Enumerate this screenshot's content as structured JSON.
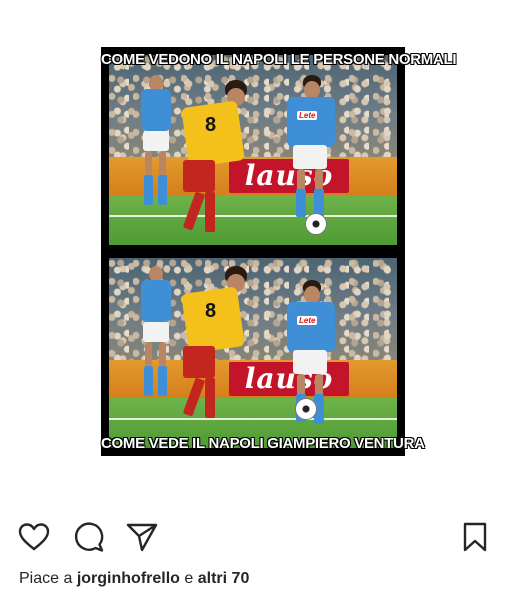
{
  "post": {
    "meme": {
      "caption_top": "COME VEDONO IL NAPOLI LE PERSONE NORMALI",
      "caption_bottom": "COME VEDE IL NAPOLI GIAMPIERO VENTURA",
      "board_text": "lauso",
      "sponsor_text": "Lete",
      "player_number": "8"
    },
    "actions": {
      "like_icon": "heart-icon",
      "comment_icon": "comment-icon",
      "share_icon": "send-icon",
      "save_icon": "bookmark-icon"
    },
    "likes": {
      "prefix": "Piace a",
      "user": "jorginhofrello",
      "connector": "e",
      "others": "altri 70"
    }
  }
}
